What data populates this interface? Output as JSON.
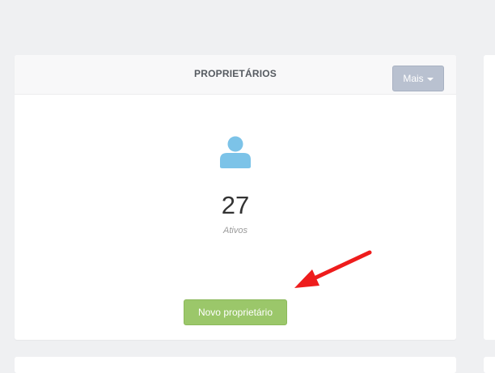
{
  "card": {
    "title": "PROPRIETÁRIOS",
    "more_button_label": "Mais",
    "stat_value": "27",
    "stat_label": "Ativos",
    "new_button_label": "Novo proprietário",
    "icon": "user-icon"
  },
  "annotation": {
    "type": "arrow",
    "color": "#ee1c1c"
  },
  "colors": {
    "page_background": "#eff0f2",
    "icon_color": "#7cc3e8",
    "primary_button": "#9bc76a",
    "more_button": "#b9c1d0"
  }
}
